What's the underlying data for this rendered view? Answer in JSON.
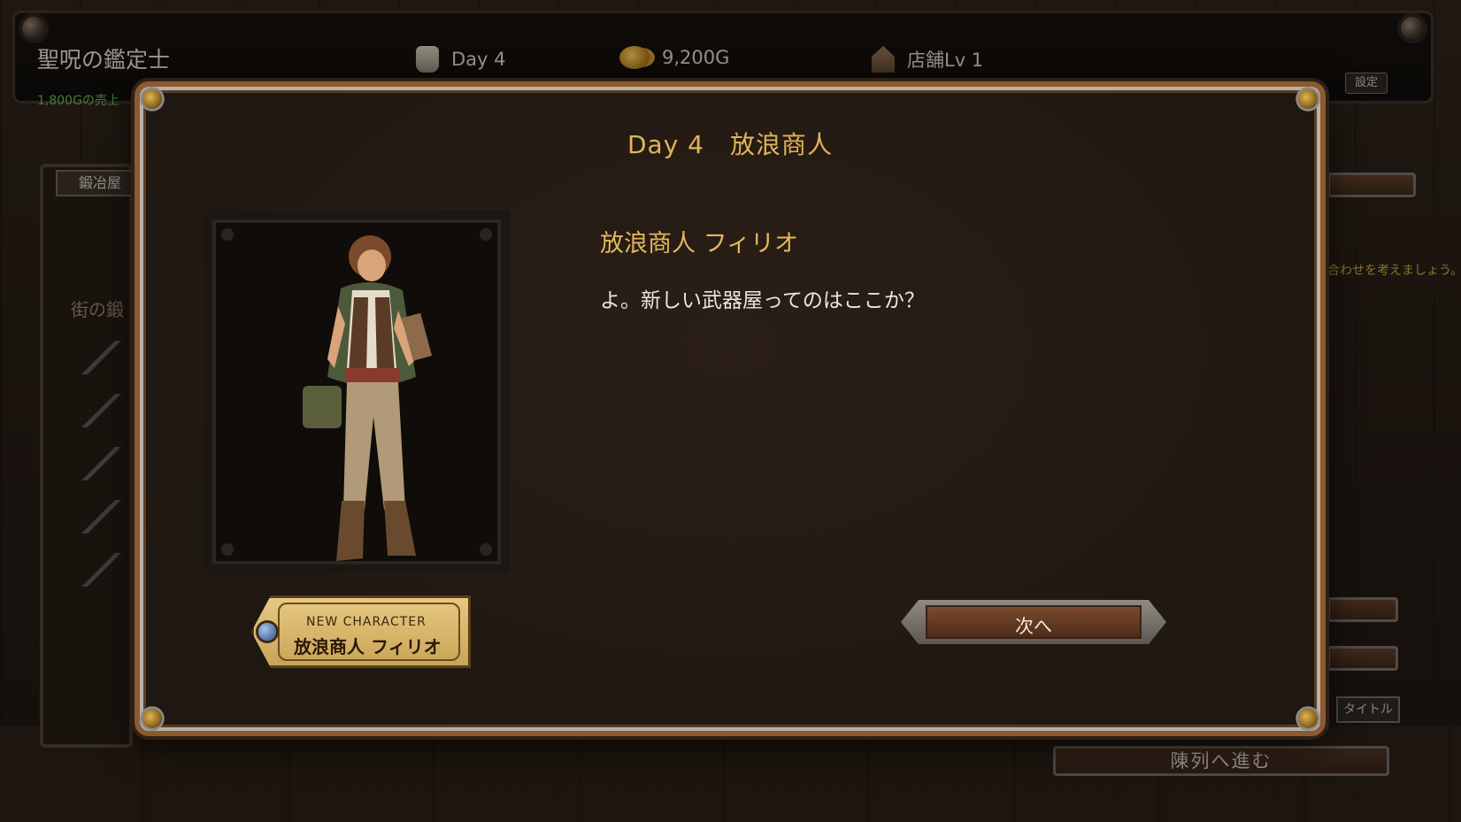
{
  "header": {
    "game_title": "聖呪の鑑定士",
    "sales_text": "1,800Gの売上",
    "day": "Day 4",
    "gold": "9,200G",
    "shop_level": "店舗Lv 1",
    "settings_label": "設定"
  },
  "left_panel": {
    "tab_label": "鍛冶屋",
    "town_label": "街の鍛"
  },
  "right_panel": {
    "hint_text": "合わせを考えましょう。",
    "title_button": "タイトル",
    "advance_button": "陳列へ進む"
  },
  "modal": {
    "title": "Day 4　放浪商人",
    "speaker": "放浪商人 フィリオ",
    "dialogue": "よ。新しい武器屋ってのはここか？",
    "new_character_label": "NEW CHARACTER",
    "new_character_name": "放浪商人 フィリオ",
    "next_button": "次へ"
  },
  "icons": {
    "day": "scroll-icon",
    "gold": "gold-coin-icon",
    "shop": "shop-icon",
    "new_character_gem": "gem-icon"
  },
  "colors": {
    "accent_gold": "#e0b458",
    "frame_copper": "#8c5a2f",
    "sales_green": "#5fae4e"
  }
}
